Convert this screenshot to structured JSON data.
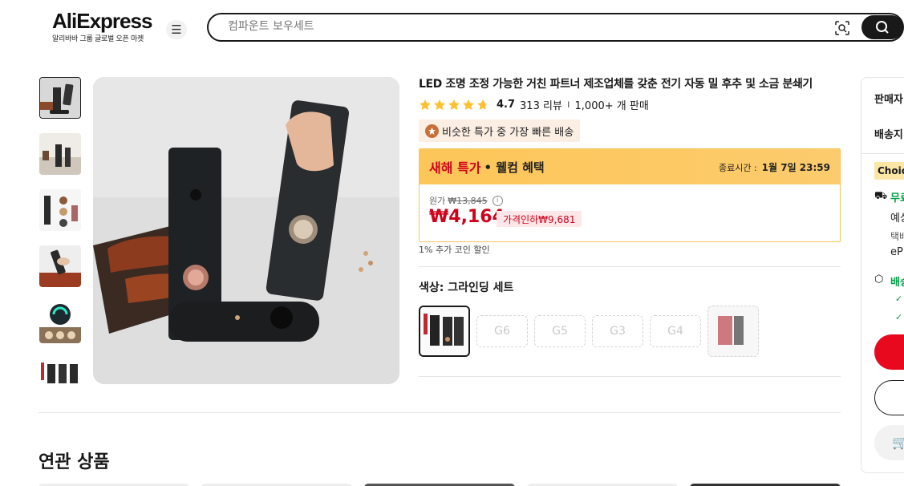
{
  "header": {
    "logo": "AliExpress",
    "logo_sub": "알리바바 그룹 글로벌 오픈 마켓",
    "search_placeholder": "컴파운트 보우세트"
  },
  "product": {
    "title": "LED 조명 조정 가능한 거친 파트너 제조업체를 갖춘 전기 자동 밀 후추 및 소금 분쇄기",
    "rating": "4.7",
    "stars": 4.7,
    "reviews": "313 리뷰",
    "sold": "1,000+ 개 판매",
    "fast_badge": "비슷한 특가 중 가장 빠른 배송",
    "deal": {
      "title": "새해 특가",
      "subtitle": "• 웰컴 혜택",
      "end_label": "종료시간 :",
      "end_time": "1월 7일 23:59",
      "orig_label": "원가",
      "orig_price": "₩13,845",
      "price": "₩4,164",
      "discount": "가격인하₩9,681"
    },
    "coin_note": "1% 추가 코인 할인",
    "color_label": "색상: 그라인딩 세트",
    "variants": [
      "G6",
      "G5",
      "G3",
      "G4"
    ]
  },
  "related_title": "연관 상품",
  "side": {
    "seller": "판매자",
    "ship_to": "배송지",
    "choice": "Choice",
    "free": "무료",
    "eta": "예상",
    "courier": "택배",
    "carrier": "eP",
    "delivery": "배송"
  },
  "colors": {
    "accent": "#e8091f",
    "deal_bg": "#fdc659",
    "choice_bg": "#fce6a6"
  }
}
